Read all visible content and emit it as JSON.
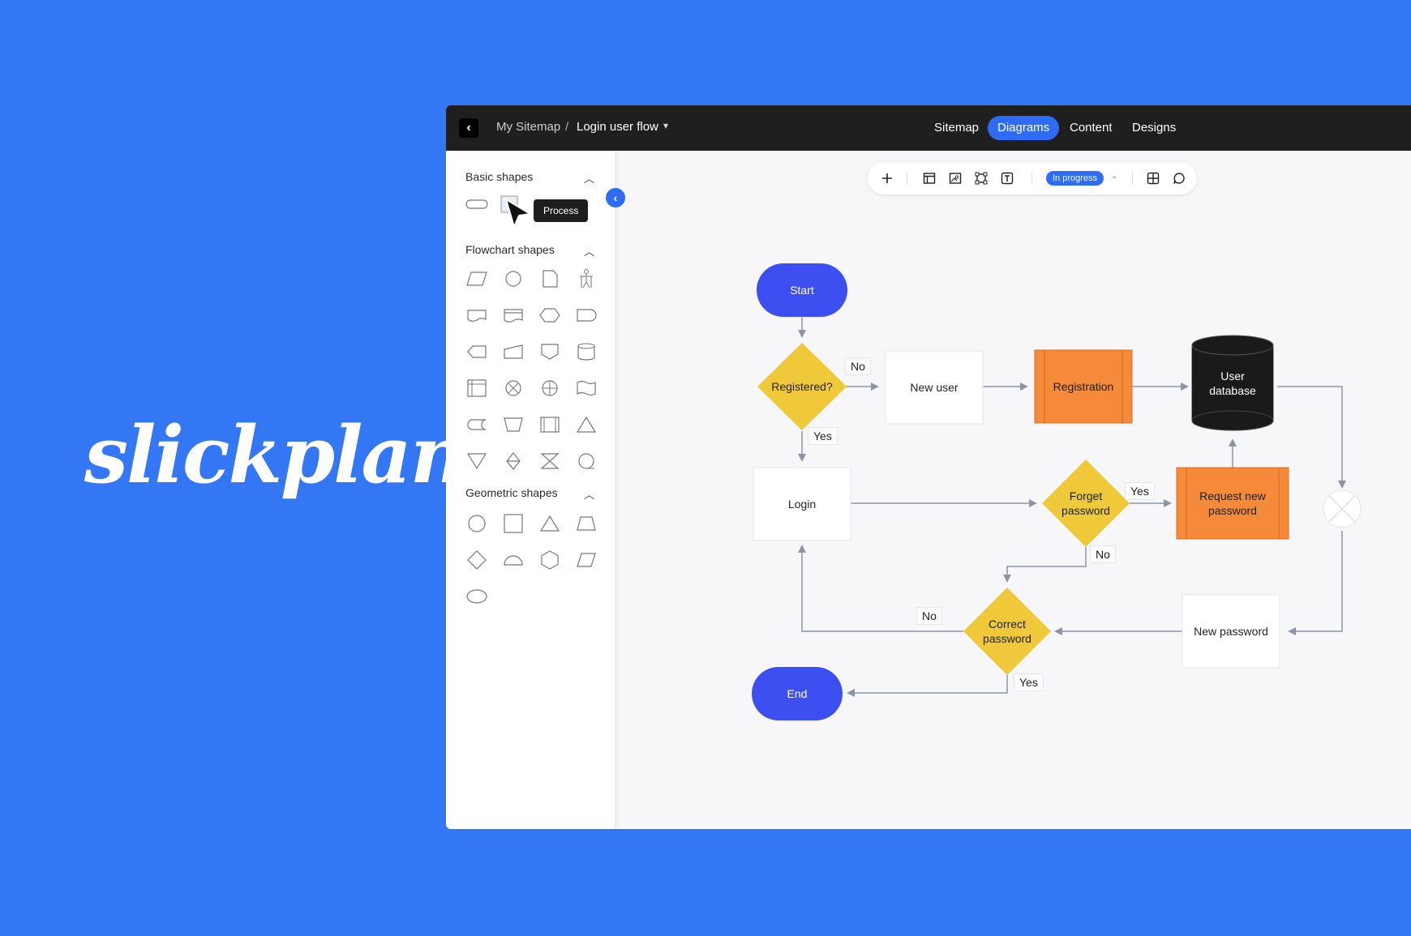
{
  "brand": {
    "logo_text": "slickplan"
  },
  "topbar": {
    "back_icon": "chevron-left-icon",
    "breadcrumb": {
      "root": "My Sitemap",
      "separator": "/",
      "current": "Login user flow"
    },
    "tabs": [
      {
        "label": "Sitemap",
        "active": false
      },
      {
        "label": "Diagrams",
        "active": true
      },
      {
        "label": "Content",
        "active": false
      },
      {
        "label": "Designs",
        "active": false
      }
    ]
  },
  "sidebar": {
    "sections": [
      {
        "title": "Basic shapes"
      },
      {
        "title": "Flowchart shapes"
      },
      {
        "title": "Geometric shapes"
      }
    ],
    "tooltip": "Process"
  },
  "toolbar": {
    "status": "In progress",
    "icons": [
      "plus-icon",
      "layout-icon",
      "image-icon",
      "frame-icon",
      "text-icon",
      "grid-icon",
      "comment-icon"
    ]
  },
  "diagram": {
    "nodes": {
      "start": "Start",
      "registered": "Registered?",
      "new_user": "New user",
      "registration": "Registration",
      "user_db": "User database",
      "login": "Login",
      "forget": "Forget password",
      "request": "Request new password",
      "correct": "Correct password",
      "new_password": "New password",
      "end": "End"
    },
    "edges": {
      "no1": "No",
      "yes1": "Yes",
      "yes2": "Yes",
      "no2": "No",
      "no3": "No",
      "yes3": "Yes"
    },
    "colors": {
      "terminal": "#3d4ff0",
      "decision": "#f0c93a",
      "process_orange": "#f58a3a",
      "database": "#1a1a1a",
      "connector": "#8a96a8"
    }
  }
}
